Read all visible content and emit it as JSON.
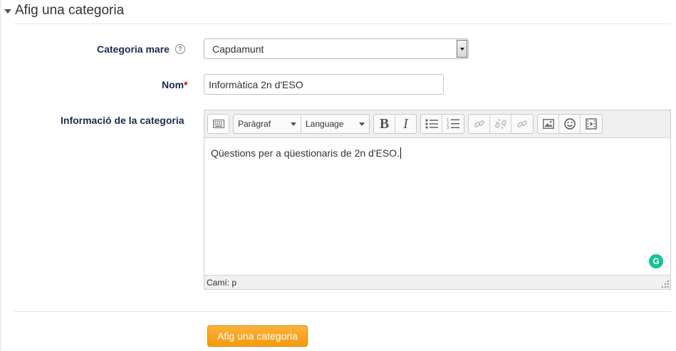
{
  "section": {
    "title": "Afig una categoria"
  },
  "fields": {
    "parent": {
      "label": "Categoria mare",
      "value": "Capdamunt"
    },
    "name": {
      "label": "Nom",
      "required_mark": "*",
      "value": "Informàtica 2n d'ESO"
    },
    "info": {
      "label": "Informació de la categoria"
    }
  },
  "editor": {
    "paragraph_label": "Paràgraf",
    "language_label": "Language",
    "content": "Qüestions per a qüestionaris de 2n d'ESO.",
    "path": "Camí: p"
  },
  "submit": {
    "label": "Afig una categoria"
  },
  "colors": {
    "accent": "#f59a0c",
    "label": "#1b2b4b",
    "required": "#cc0000",
    "grammarly": "#15c39a"
  }
}
